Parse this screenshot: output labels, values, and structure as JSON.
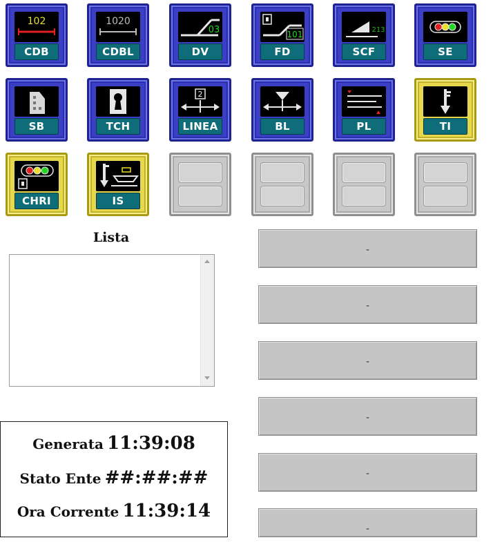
{
  "tiles": [
    {
      "label": "CDB",
      "style": "blue",
      "icon": "track-circuit-icon",
      "screen_text": "102"
    },
    {
      "label": "CDBL",
      "style": "blue",
      "icon": "track-circuit-long-icon",
      "screen_text": "1020"
    },
    {
      "label": "DV",
      "style": "blue",
      "icon": "switch-deviator-icon",
      "screen_text": "03"
    },
    {
      "label": "FD",
      "style": "blue",
      "icon": "switch-lock-icon",
      "screen_text": "101"
    },
    {
      "label": "SCF",
      "style": "blue",
      "icon": "scf-ramp-icon",
      "screen_text": "213"
    },
    {
      "label": "SE",
      "style": "blue",
      "icon": "traffic-signal-icon",
      "screen_text": ""
    },
    {
      "label": "SB",
      "style": "blue",
      "icon": "signal-box-icon",
      "screen_text": ""
    },
    {
      "label": "TCH",
      "style": "blue",
      "icon": "keyhole-icon",
      "screen_text": ""
    },
    {
      "label": "LINEA",
      "style": "blue",
      "icon": "line-direction-icon",
      "screen_text": "2"
    },
    {
      "label": "BL",
      "style": "blue",
      "icon": "block-arrows-icon",
      "screen_text": ""
    },
    {
      "label": "PL",
      "style": "blue",
      "icon": "level-crossing-icon",
      "screen_text": ""
    },
    {
      "label": "TI",
      "style": "yellow",
      "icon": "key-down-icon",
      "screen_text": ""
    },
    {
      "label": "CHRI",
      "style": "yellow",
      "icon": "signal-with-lock-icon",
      "screen_text": ""
    },
    {
      "label": "IS",
      "style": "yellow",
      "icon": "key-with-ramp-icon",
      "screen_text": ""
    },
    {
      "label": "",
      "style": "grey",
      "icon": "",
      "screen_text": ""
    },
    {
      "label": "",
      "style": "grey",
      "icon": "",
      "screen_text": ""
    },
    {
      "label": "",
      "style": "grey",
      "icon": "",
      "screen_text": ""
    },
    {
      "label": "",
      "style": "grey",
      "icon": "",
      "screen_text": ""
    }
  ],
  "list": {
    "title": "Lista",
    "items": []
  },
  "status": {
    "generated_label": "Generata",
    "generated_value": "11:39:08",
    "state_label": "Stato Ente",
    "state_value": "##:##:##",
    "current_label": "Ora Corrente",
    "current_value": "11:39:14"
  },
  "right_buttons": [
    "-",
    "-",
    "-",
    "-",
    "-",
    "-"
  ],
  "colors": {
    "tile_blue": "#3a3fc6",
    "tile_yellow": "#e6d84a",
    "tile_grey": "#c8c8c8",
    "label_teal": "#0f6d7a",
    "screen_green": "#1fd81f",
    "screen_yellow": "#e8e02a",
    "screen_red": "#e02020"
  }
}
